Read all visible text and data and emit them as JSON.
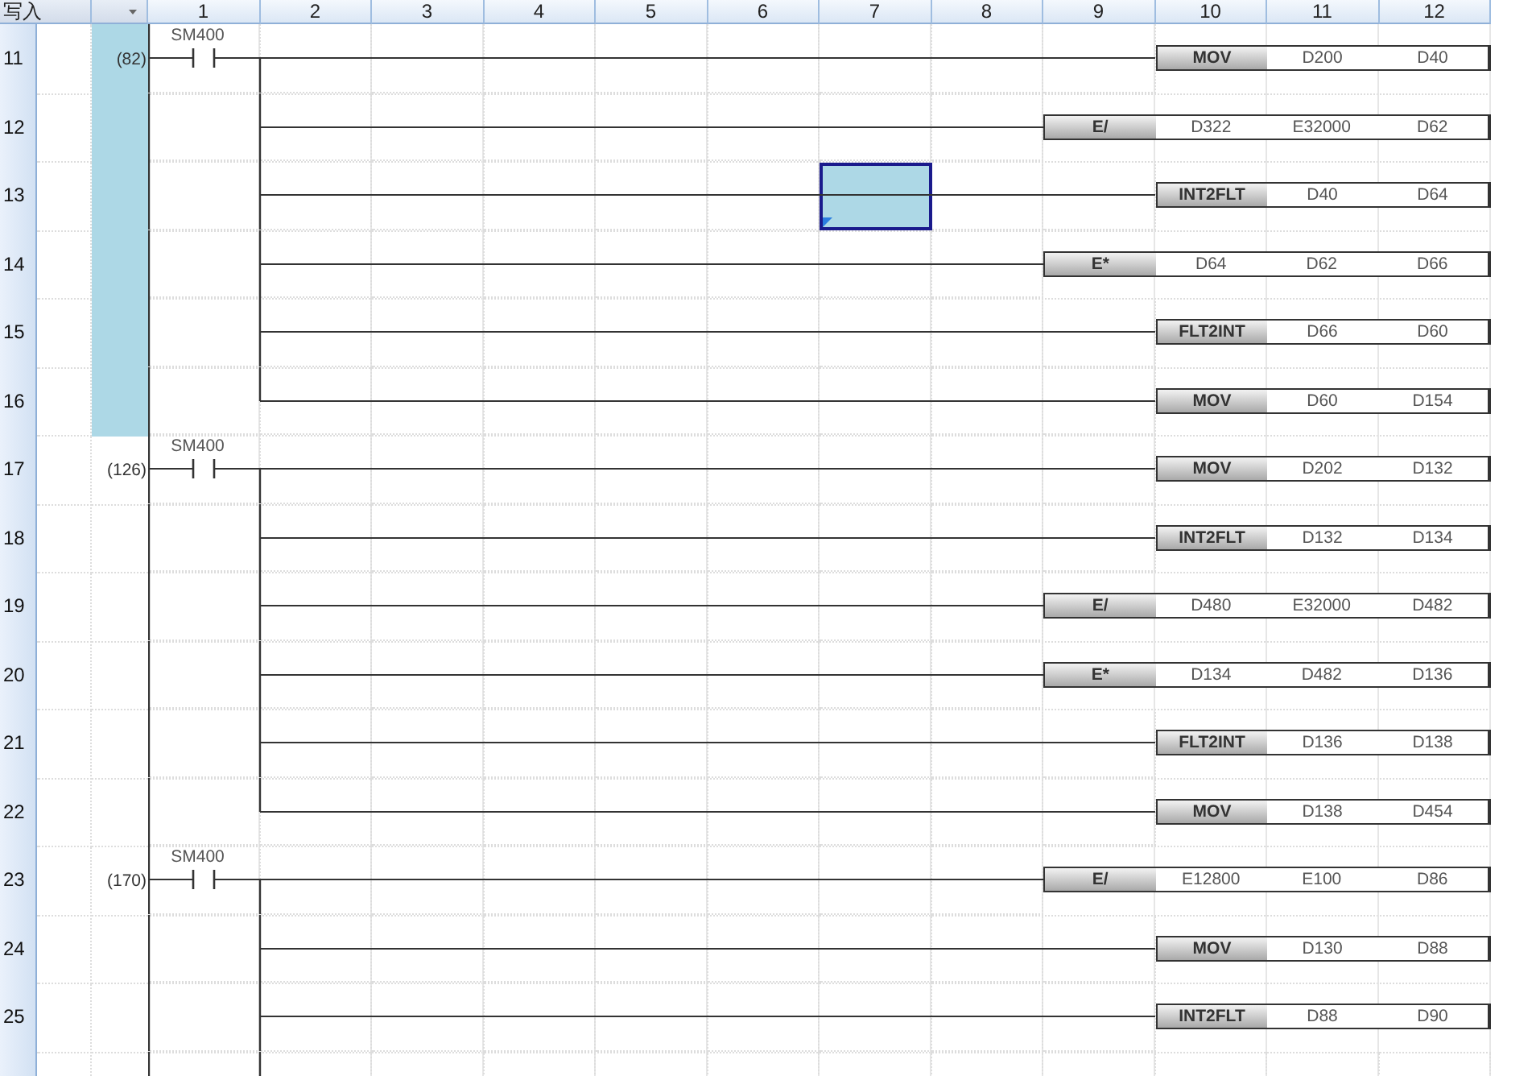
{
  "header": {
    "corner": "写入",
    "columns": [
      "1",
      "2",
      "3",
      "4",
      "5",
      "6",
      "7",
      "8",
      "9",
      "10",
      "11",
      "12"
    ]
  },
  "rows": [
    {
      "number": "11",
      "step": "(82)",
      "step_selected": true,
      "contact": "SM400",
      "instruction": {
        "op": "MOV",
        "operands": [
          "D200",
          "D40"
        ]
      },
      "cell_selected": [
        false,
        false,
        false,
        false,
        false,
        false,
        false,
        false,
        false,
        false,
        false,
        false
      ]
    },
    {
      "number": "12",
      "step_selected": true,
      "instruction": {
        "op": "E/",
        "operands": [
          "D322",
          "E32000",
          "D62"
        ]
      },
      "cell_selected": [
        false,
        false,
        false,
        false,
        false,
        false,
        false,
        false,
        false,
        false,
        false,
        false
      ]
    },
    {
      "number": "13",
      "step_selected": true,
      "instruction": {
        "op": "INT2FLT",
        "operands": [
          "D40",
          "D64"
        ]
      },
      "cell_selected": [
        false,
        false,
        false,
        false,
        false,
        false,
        true,
        false,
        false,
        false,
        false,
        false
      ]
    },
    {
      "number": "14",
      "step_selected": true,
      "instruction": {
        "op": "E*",
        "operands": [
          "D64",
          "D62",
          "D66"
        ]
      },
      "cell_selected": [
        false,
        false,
        false,
        false,
        false,
        false,
        false,
        false,
        false,
        false,
        false,
        false
      ]
    },
    {
      "number": "15",
      "step_selected": true,
      "instruction": {
        "op": "FLT2INT",
        "operands": [
          "D66",
          "D60"
        ]
      },
      "cell_selected": [
        false,
        false,
        false,
        false,
        false,
        false,
        false,
        false,
        false,
        false,
        false,
        false
      ]
    },
    {
      "number": "16",
      "step_selected": true,
      "instruction": {
        "op": "MOV",
        "operands": [
          "D60",
          "D154"
        ]
      },
      "cell_selected": [
        false,
        false,
        false,
        false,
        false,
        false,
        false,
        false,
        false,
        false,
        false,
        false
      ]
    },
    {
      "number": "17",
      "step": "(126)",
      "step_selected": false,
      "contact": "SM400",
      "instruction": {
        "op": "MOV",
        "operands": [
          "D202",
          "D132"
        ]
      },
      "cell_selected": [
        false,
        false,
        false,
        false,
        false,
        false,
        false,
        false,
        false,
        false,
        false,
        false
      ]
    },
    {
      "number": "18",
      "step_selected": false,
      "instruction": {
        "op": "INT2FLT",
        "operands": [
          "D132",
          "D134"
        ]
      },
      "cell_selected": [
        false,
        false,
        false,
        false,
        false,
        false,
        false,
        false,
        false,
        false,
        false,
        false
      ]
    },
    {
      "number": "19",
      "step_selected": false,
      "instruction": {
        "op": "E/",
        "operands": [
          "D480",
          "E32000",
          "D482"
        ]
      },
      "cell_selected": [
        false,
        false,
        false,
        false,
        false,
        false,
        false,
        false,
        false,
        false,
        false,
        false
      ]
    },
    {
      "number": "20",
      "step_selected": false,
      "instruction": {
        "op": "E*",
        "operands": [
          "D134",
          "D482",
          "D136"
        ]
      },
      "cell_selected": [
        false,
        false,
        false,
        false,
        false,
        false,
        false,
        false,
        false,
        false,
        false,
        false
      ]
    },
    {
      "number": "21",
      "step_selected": false,
      "instruction": {
        "op": "FLT2INT",
        "operands": [
          "D136",
          "D138"
        ]
      },
      "cell_selected": [
        false,
        false,
        false,
        false,
        false,
        false,
        false,
        false,
        false,
        false,
        false,
        false
      ]
    },
    {
      "number": "22",
      "step_selected": false,
      "instruction": {
        "op": "MOV",
        "operands": [
          "D138",
          "D454"
        ]
      },
      "cell_selected": [
        false,
        false,
        false,
        false,
        false,
        false,
        false,
        false,
        false,
        false,
        false,
        false
      ]
    },
    {
      "number": "23",
      "step": "(170)",
      "step_selected": false,
      "contact": "SM400",
      "instruction": {
        "op": "E/",
        "operands": [
          "E12800",
          "E100",
          "D86"
        ]
      },
      "cell_selected": [
        false,
        false,
        false,
        false,
        false,
        false,
        false,
        false,
        false,
        false,
        false,
        false
      ]
    },
    {
      "number": "24",
      "step_selected": false,
      "instruction": {
        "op": "MOV",
        "operands": [
          "D130",
          "D88"
        ]
      },
      "cell_selected": [
        false,
        false,
        false,
        false,
        false,
        false,
        false,
        false,
        false,
        false,
        false,
        false
      ]
    },
    {
      "number": "25",
      "step_selected": false,
      "instruction": {
        "op": "INT2FLT",
        "operands": [
          "D88",
          "D90"
        ]
      },
      "cell_selected": [
        false,
        false,
        false,
        false,
        false,
        false,
        false,
        false,
        false,
        false,
        false,
        false
      ]
    }
  ]
}
